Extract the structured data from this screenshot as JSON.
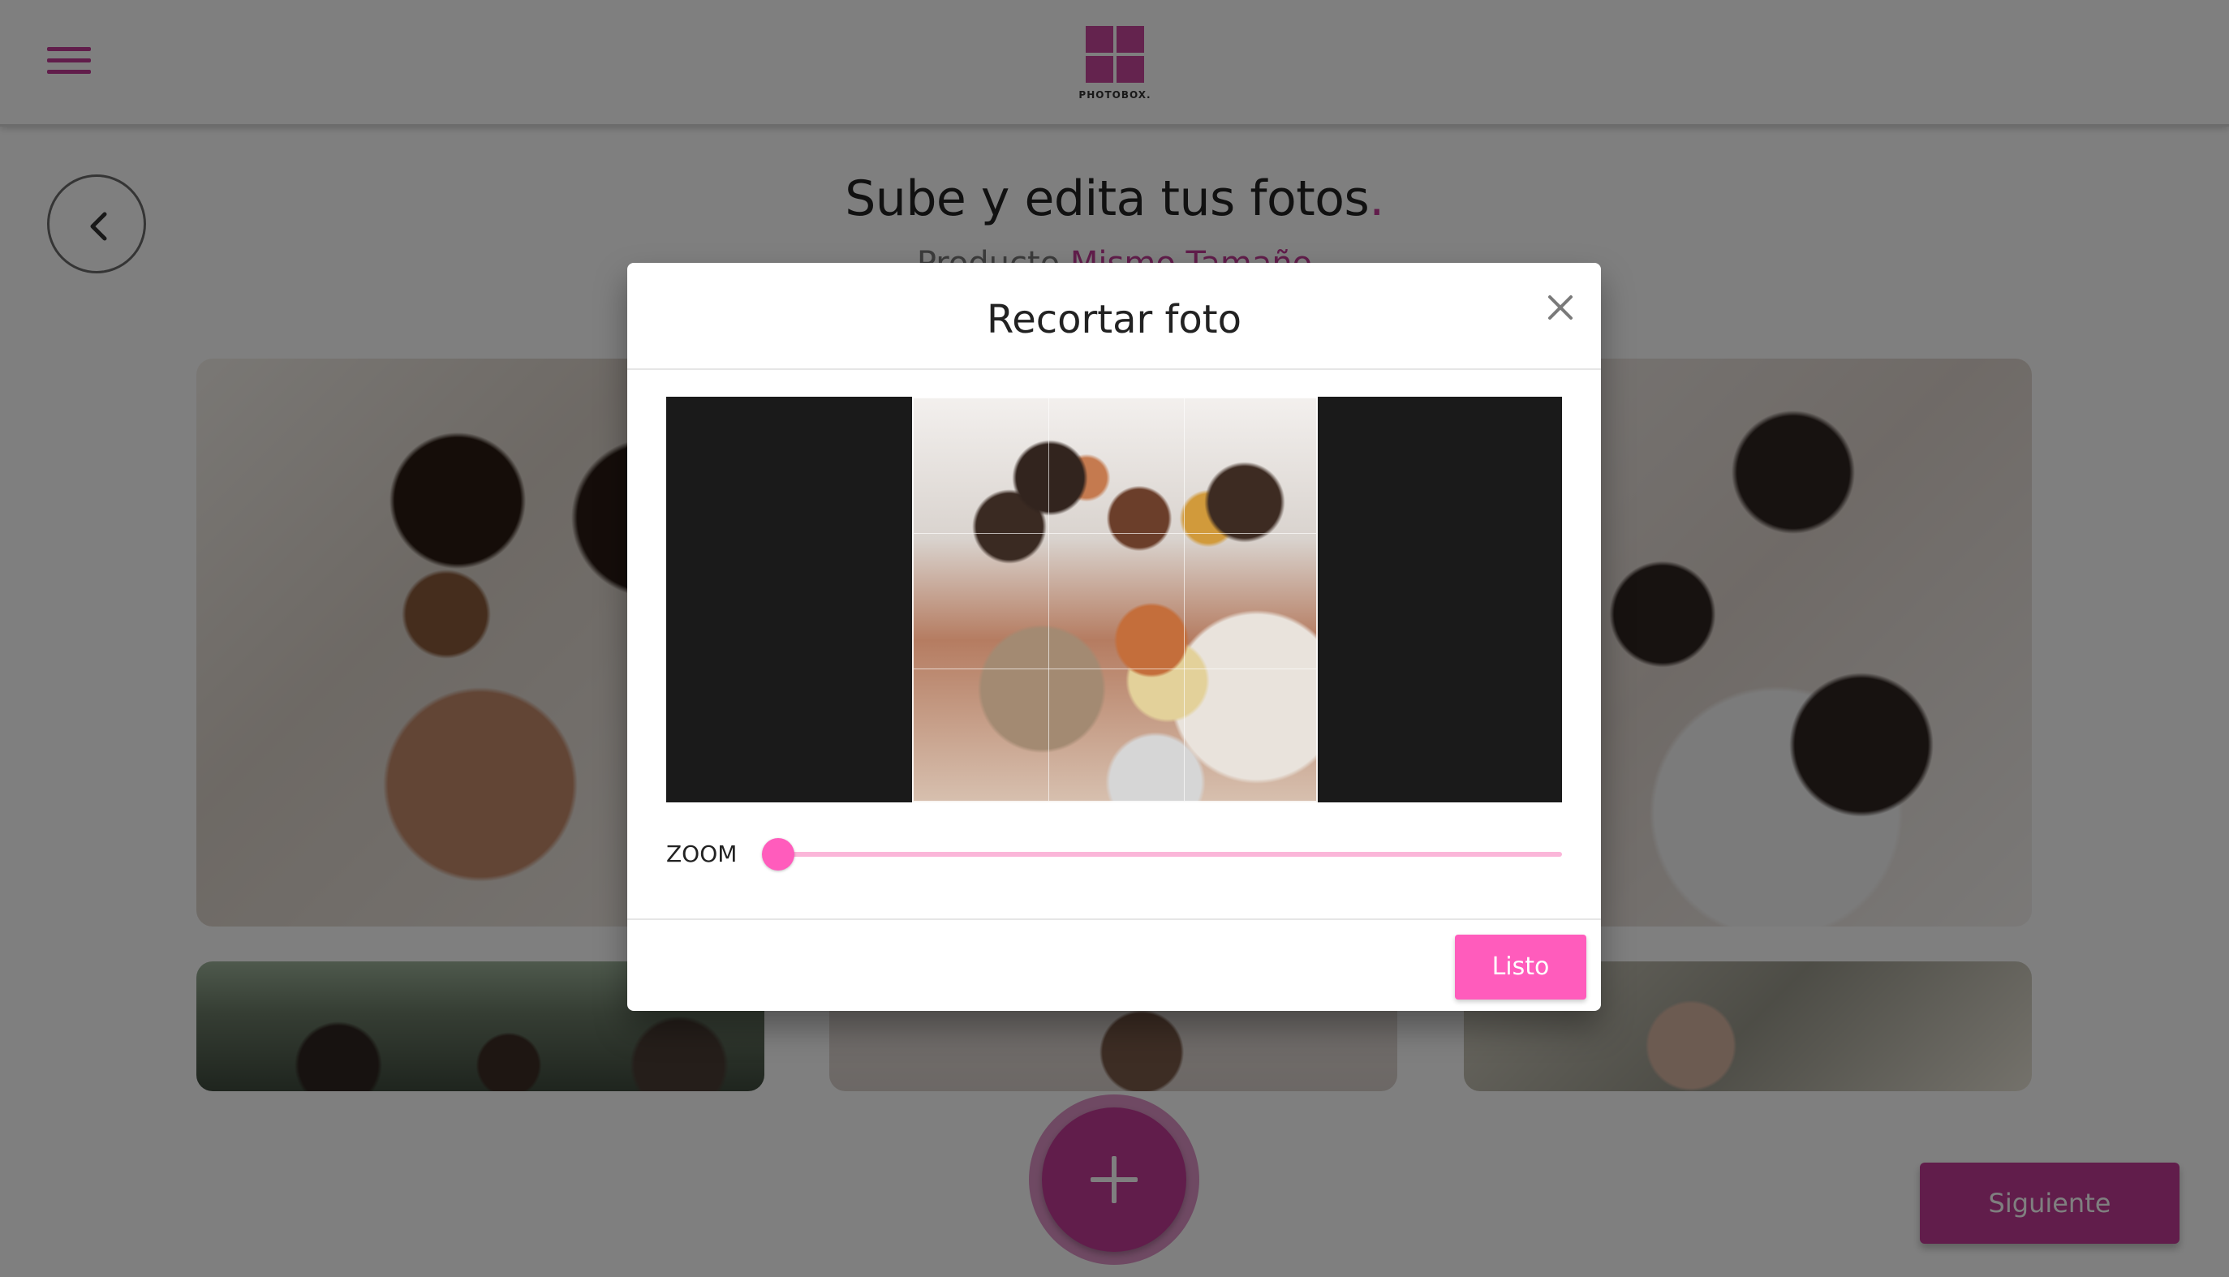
{
  "app": {
    "logo_text": "PHOTOBOX."
  },
  "page": {
    "title": "Sube y edita tus fotos",
    "title_dot": ".",
    "subtitle_prefix": "Producto",
    "subtitle_product": "Mismo Tamaño"
  },
  "actions": {
    "next_label": "Siguiente"
  },
  "modal": {
    "title": "Recortar foto",
    "zoom_label": "ZOOM",
    "zoom_value": 0,
    "done_label": "Listo"
  },
  "colors": {
    "brand": "#c33a97",
    "accent": "#ff5cbc",
    "track": "#fbb6d9",
    "crop_bg": "#1a1a1a"
  },
  "icons": {
    "menu": "hamburger-icon",
    "back": "chevron-left-icon",
    "close": "close-icon",
    "add": "plus-icon"
  }
}
